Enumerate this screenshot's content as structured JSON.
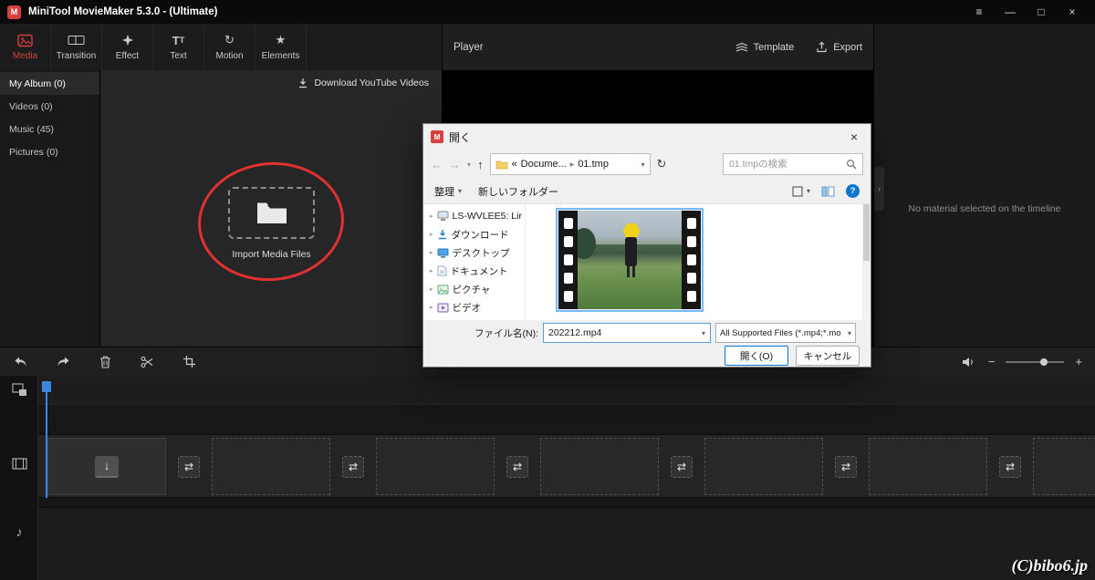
{
  "colors": {
    "accent": "#d84040",
    "playhead": "#3f86e0",
    "dlgaccent": "#0078d7",
    "hexagon": "#f2d119"
  },
  "titlebar": {
    "title": "MiniTool MovieMaker 5.3.0 - (Ultimate)"
  },
  "icons": {
    "menu": "≡",
    "minimize": "—",
    "maximize": "□",
    "close": "×",
    "back": "←",
    "forward": "→",
    "up": "↑",
    "caret_down": "▾",
    "expander": "▸",
    "chevron_right": "›",
    "refresh": "↻",
    "transition": "⇄",
    "download_arrow": "↓",
    "music_note": "♪",
    "collapse": "›",
    "minus": "−",
    "plus": "+",
    "motion": "↻",
    "star": "★"
  },
  "tabs": [
    {
      "label": "Media",
      "active": true
    },
    {
      "label": "Transition",
      "active": false
    },
    {
      "label": "Effect",
      "active": false
    },
    {
      "label": "Text",
      "active": false
    },
    {
      "label": "Motion",
      "active": false
    },
    {
      "label": "Elements",
      "active": false
    }
  ],
  "sidebar": {
    "items": [
      {
        "label": "My Album (0)",
        "active": true
      },
      {
        "label": "Videos (0)",
        "active": false
      },
      {
        "label": "Music (45)",
        "active": false
      },
      {
        "label": "Pictures (0)",
        "active": false
      }
    ]
  },
  "media_panel": {
    "download_link": "Download YouTube Videos",
    "import_label": "Import Media Files"
  },
  "player": {
    "title": "Player",
    "template_label": "Template",
    "export_label": "Export"
  },
  "right_panel": {
    "empty_message": "No material selected on the timeline"
  },
  "dialog": {
    "title": "開く",
    "breadcrumb": {
      "overflow": "«",
      "parent": "Docume...",
      "current": "01.tmp"
    },
    "search_placeholder": "01.tmpの検索",
    "organize_label": "整理",
    "new_folder_label": "新しいフォルダー",
    "tree_items": [
      "LS-WVLEE5: Lir",
      "ダウンロード",
      "デスクトップ",
      "ドキュメント",
      "ピクチャ",
      "ビデオ"
    ],
    "filename_label": "ファイル名(N):",
    "filename_value": "202212.mp4",
    "filetype_value": "All Supported Files (*.mp4;*.mo",
    "open_button": "開く(O)",
    "cancel_button": "キャンセル"
  },
  "watermark": "(C)bibo6.jp"
}
